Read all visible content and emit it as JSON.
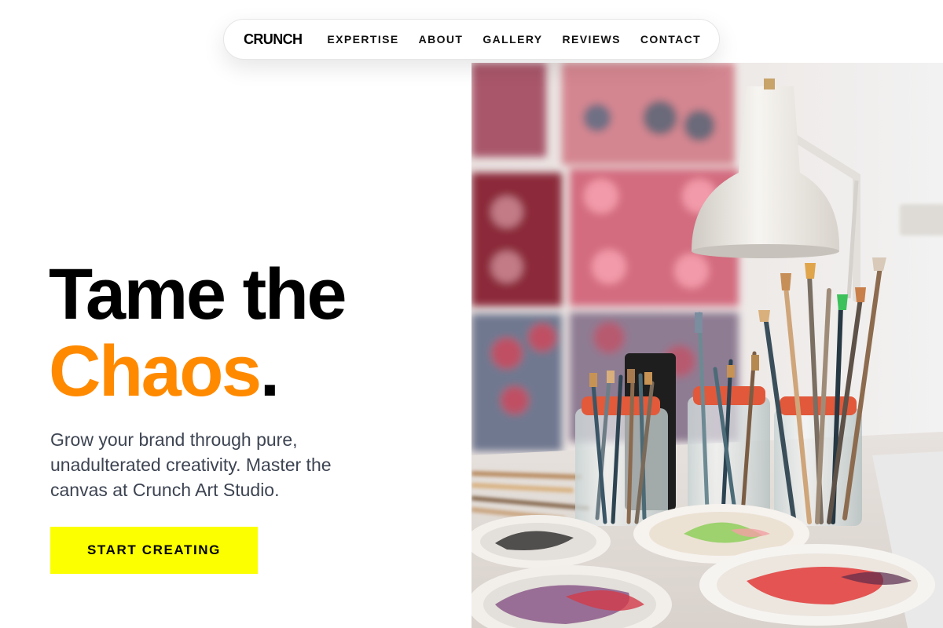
{
  "nav": {
    "brand": "CRUNCH",
    "links": [
      "EXPERTISE",
      "ABOUT",
      "GALLERY",
      "REVIEWS",
      "CONTACT"
    ]
  },
  "hero": {
    "title_line1": "Tame the",
    "title_accent": "Chaos",
    "title_period": ".",
    "subtitle": "Grow your brand through pure, unadulterated creativity. Master the canvas at Crunch Art Studio.",
    "cta_label": "START CREATING"
  },
  "image": {
    "subject": "art studio with paintbrush jars, desk lamp and paint palettes"
  },
  "colors": {
    "accent_orange": "#ff8a00",
    "cta_yellow": "#fbff00",
    "text_dark": "#000000",
    "text_body": "#3d4452"
  }
}
